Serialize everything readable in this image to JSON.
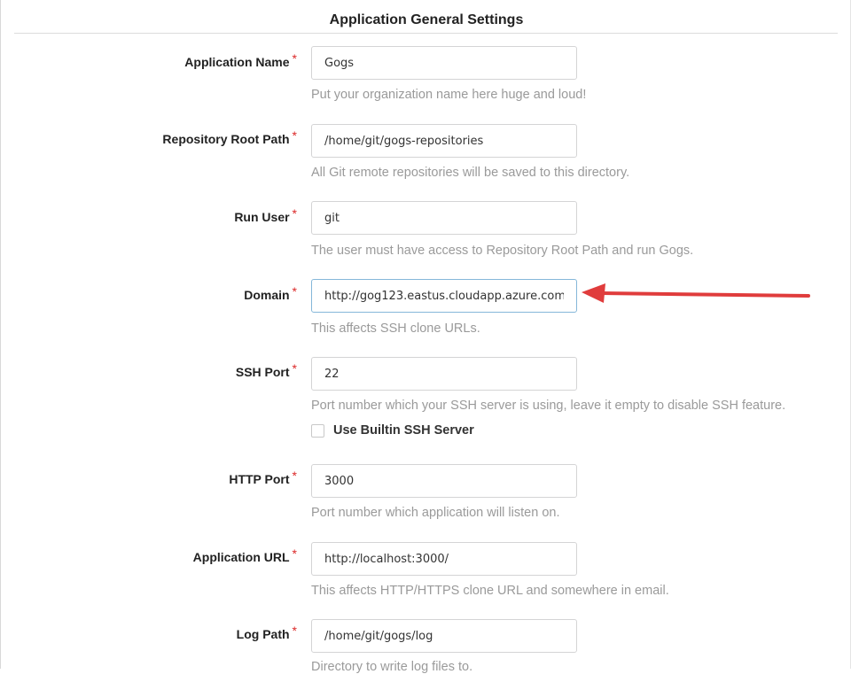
{
  "section": {
    "title": "Application General Settings"
  },
  "required_marker": "*",
  "fields": [
    {
      "label": "Application Name",
      "value": "Gogs",
      "help": "Put your organization name here huge and loud!"
    },
    {
      "label": "Repository Root Path",
      "value": "/home/git/gogs-repositories",
      "help": "All Git remote repositories will be saved to this directory."
    },
    {
      "label": "Run User",
      "value": "git",
      "help": "The user must have access to Repository Root Path and run Gogs."
    },
    {
      "label": "Domain",
      "value": "http://gog123.eastus.cloudapp.azure.com",
      "help": "This affects SSH clone URLs."
    },
    {
      "label": "SSH Port",
      "value": "22",
      "help": "Port number which your SSH server is using, leave it empty to disable SSH feature."
    },
    {
      "label": "HTTP Port",
      "value": "3000",
      "help": "Port number which application will listen on."
    },
    {
      "label": "Application URL",
      "value": "http://localhost:3000/",
      "help": "This affects HTTP/HTTPS clone URL and somewhere in email."
    },
    {
      "label": "Log Path",
      "value": "/home/git/gogs/log",
      "help": "Directory to write log files to."
    }
  ],
  "builtin_ssh": {
    "label": "Use Builtin SSH Server",
    "checked": false
  },
  "colors": {
    "required": "#db2828",
    "arrow": "#e03c3c",
    "focus_border": "#85b7d9"
  }
}
